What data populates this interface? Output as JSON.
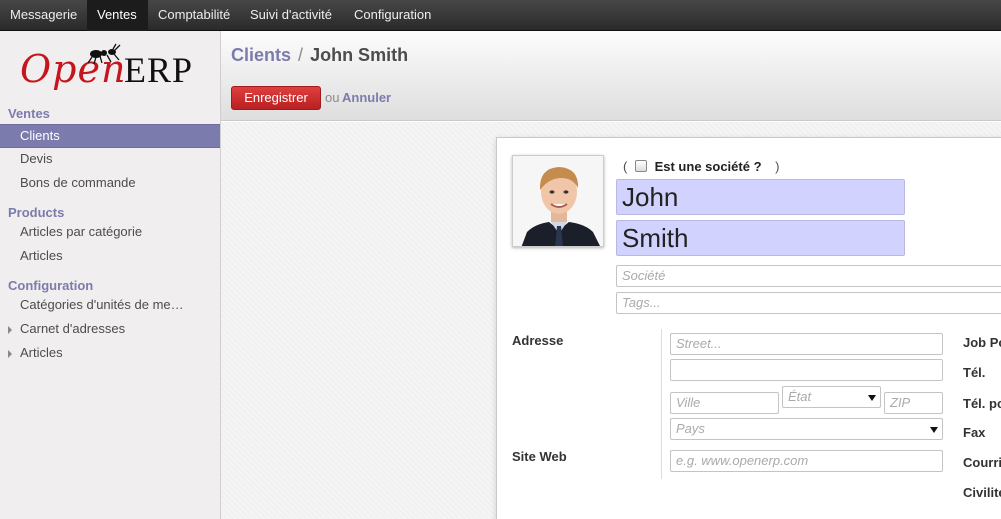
{
  "top_menu": [
    "Messagerie",
    "Ventes",
    "Comptabilité",
    "Suivi d'activité",
    "Configuration"
  ],
  "logo": {
    "open": "Open",
    "erp": "ERP"
  },
  "sidebar": {
    "sections": [
      {
        "title": "Ventes",
        "items": [
          "Clients",
          "Devis",
          "Bons de commande"
        ]
      },
      {
        "title": "Products",
        "items": [
          "Articles par catégorie",
          "Articles"
        ]
      },
      {
        "title": "Configuration",
        "items": [
          "Catégories d'unités de me…",
          "Carnet d'adresses",
          "Articles"
        ]
      }
    ]
  },
  "breadcrumb": {
    "parent": "Clients",
    "separator": "/",
    "current": "John Smith"
  },
  "actions": {
    "save": "Enregistrer",
    "or": "ou",
    "cancel": "Annuler"
  },
  "form": {
    "is_company": {
      "open_paren": "(",
      "label": "Est une société ?",
      "close_paren": ")",
      "checked": false
    },
    "first_name": "John",
    "last_name": "Smith",
    "company_placeholder": "Société",
    "tags_placeholder": "Tags...",
    "address_label": "Adresse",
    "street_placeholder": "Street...",
    "city_placeholder": "Ville",
    "state_placeholder": "État",
    "zip_placeholder": "ZIP",
    "country_placeholder": "Pays",
    "website_label": "Site Web",
    "website_placeholder": "e.g. www.openerp.com",
    "right_labels": [
      "Job Po",
      "Tél.",
      "Tél. po",
      "Fax",
      "Courri",
      "Civilité"
    ]
  },
  "colors": {
    "accent": "#7c7bad",
    "save_button": "#c62828",
    "name_field_bg": "#d2d2ff",
    "topbar": "#333333"
  }
}
